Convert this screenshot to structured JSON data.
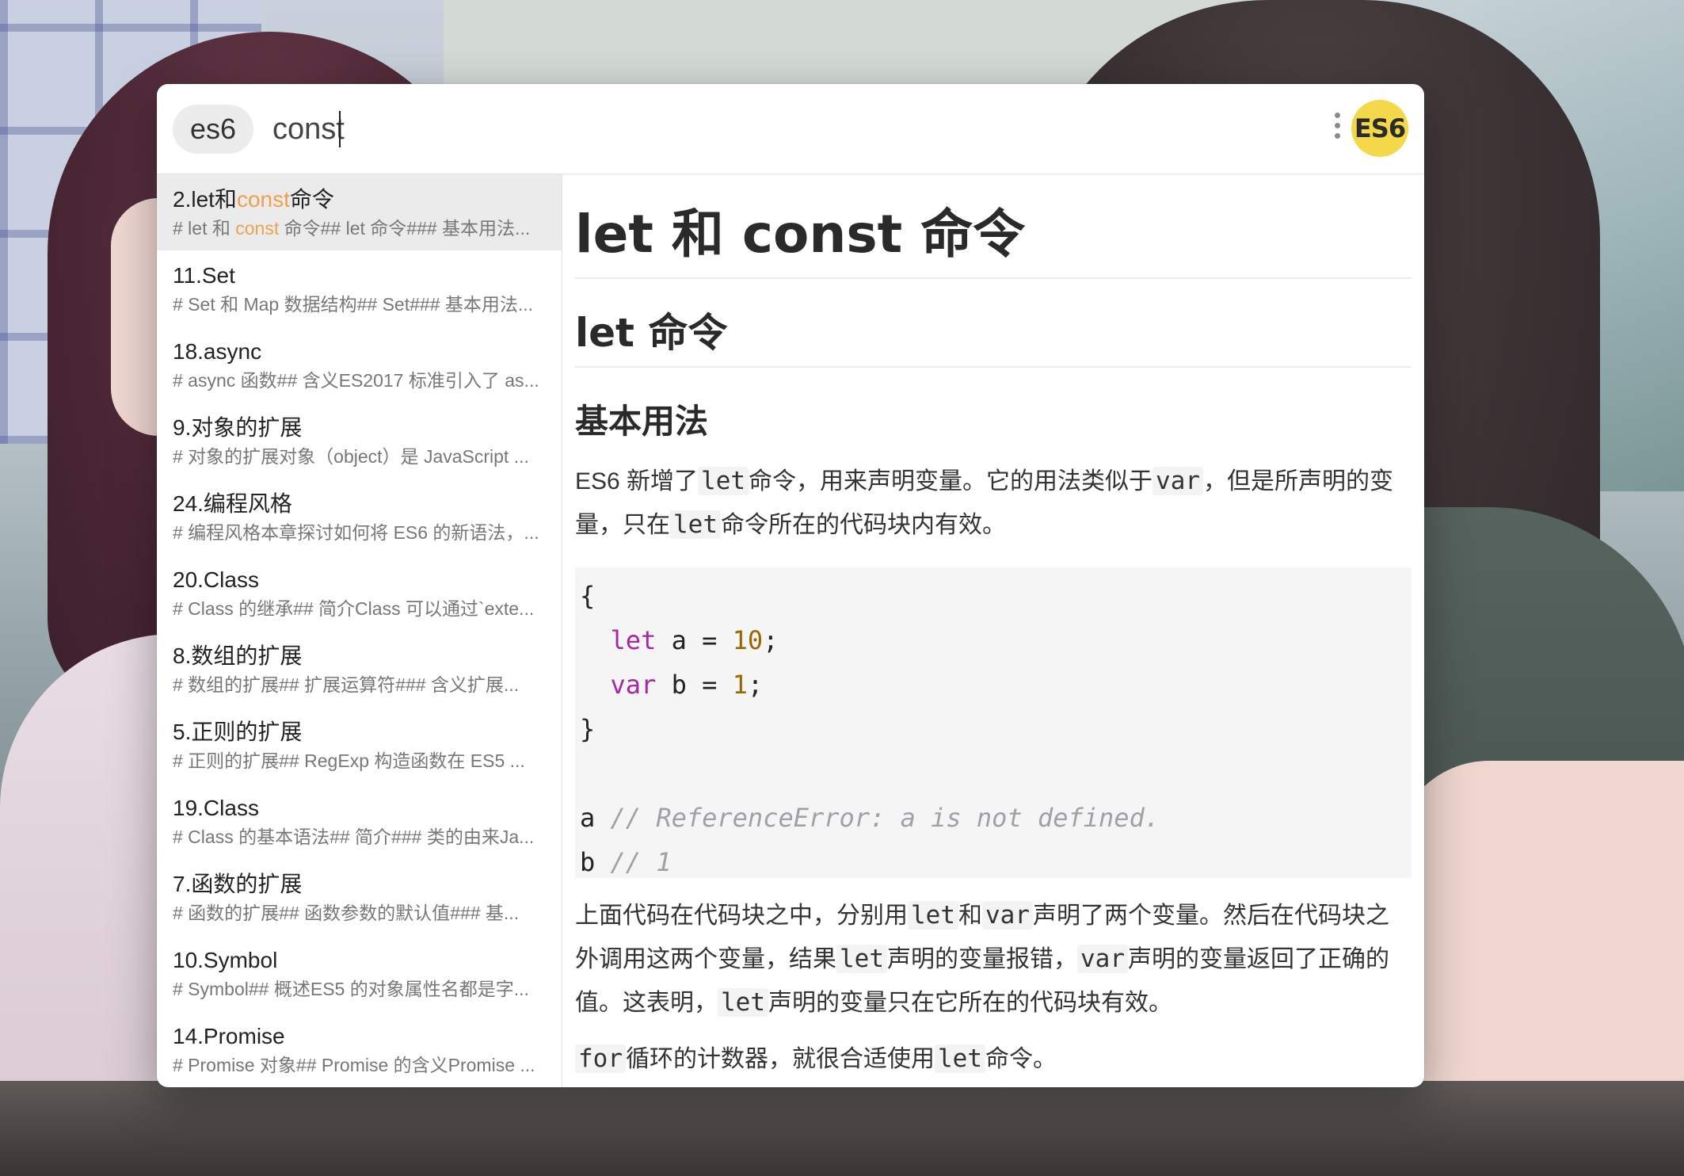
{
  "search": {
    "keyword": "es6",
    "query": "const",
    "badge": "ES6"
  },
  "results": [
    {
      "title_pre": "2.let和",
      "title_hl": "const",
      "title_post": "命令",
      "snippet_pre": "# let 和 ",
      "snippet_hl": "const",
      "snippet_post": " 命令## let 命令### 基本用法...",
      "selected": true
    },
    {
      "title": "11.Set",
      "snippet": "# Set 和 Map 数据结构## Set### 基本用法..."
    },
    {
      "title": "18.async",
      "snippet": "# async 函数## 含义ES2017 标准引入了 as..."
    },
    {
      "title": "9.对象的扩展",
      "snippet": "# 对象的扩展对象（object）是 JavaScript ..."
    },
    {
      "title": "24.编程风格",
      "snippet": "# 编程风格本章探讨如何将 ES6 的新语法，..."
    },
    {
      "title": "20.Class",
      "snippet": "# Class 的继承## 简介Class 可以通过`exte..."
    },
    {
      "title": "8.数组的扩展",
      "snippet": "# 数组的扩展## 扩展运算符### 含义扩展..."
    },
    {
      "title": "5.正则的扩展",
      "snippet": "# 正则的扩展## RegExp 构造函数在 ES5 ..."
    },
    {
      "title": "19.Class",
      "snippet": "# Class 的基本语法## 简介### 类的由来Ja..."
    },
    {
      "title": "7.函数的扩展",
      "snippet": "# 函数的扩展## 函数参数的默认值### 基..."
    },
    {
      "title": "10.Symbol",
      "snippet": "# Symbol## 概述ES5 的对象属性名都是字..."
    },
    {
      "title": "14.Promise",
      "snippet": "# Promise 对象## Promise 的含义Promise ..."
    }
  ],
  "preview": {
    "h1": "let 和 const 命令",
    "h2": "let 命令",
    "h3": "基本用法",
    "para1": {
      "t1": "ES6 新增了",
      "c1": "let",
      "t2": "命令，用来声明变量。它的用法类似于",
      "c2": "var",
      "t3": "，但是所声明的变量，只在",
      "c3": "let",
      "t4": "命令所在的代码块内有效。"
    },
    "code": {
      "l1": "{",
      "l2_kw": "let",
      "l2_mid": " a = ",
      "l2_num": "10",
      "l2_end": ";",
      "l3_kw": "var",
      "l3_mid": " b = ",
      "l3_num": "1",
      "l3_end": ";",
      "l4": "}",
      "l6_var": "a",
      "l6_cmt": "// ReferenceError: a is not defined.",
      "l7_var": "b",
      "l7_cmt": "// 1"
    },
    "para2": {
      "t1": "上面代码在代码块之中，分别用",
      "c1": "let",
      "t2": "和",
      "c2": "var",
      "t3": "声明了两个变量。然后在代码块之外调用这两个变量，结果",
      "c3": "let",
      "t4": "声明的变量报错，",
      "c4": "var",
      "t5": "声明的变量返回了正确的值。这表明，",
      "c5": "let",
      "t6": "声明的变量只在它所在的代码块有效。"
    },
    "para3": {
      "c1": "for",
      "t1": "循环的计数器，就很合适使用",
      "c2": "let",
      "t2": "命令。"
    }
  },
  "colors": {
    "highlight": "#f0a04c",
    "badge": "#f3d94a",
    "keyword": "#a626a4",
    "number": "#986801",
    "comment": "#a0a1a7"
  }
}
